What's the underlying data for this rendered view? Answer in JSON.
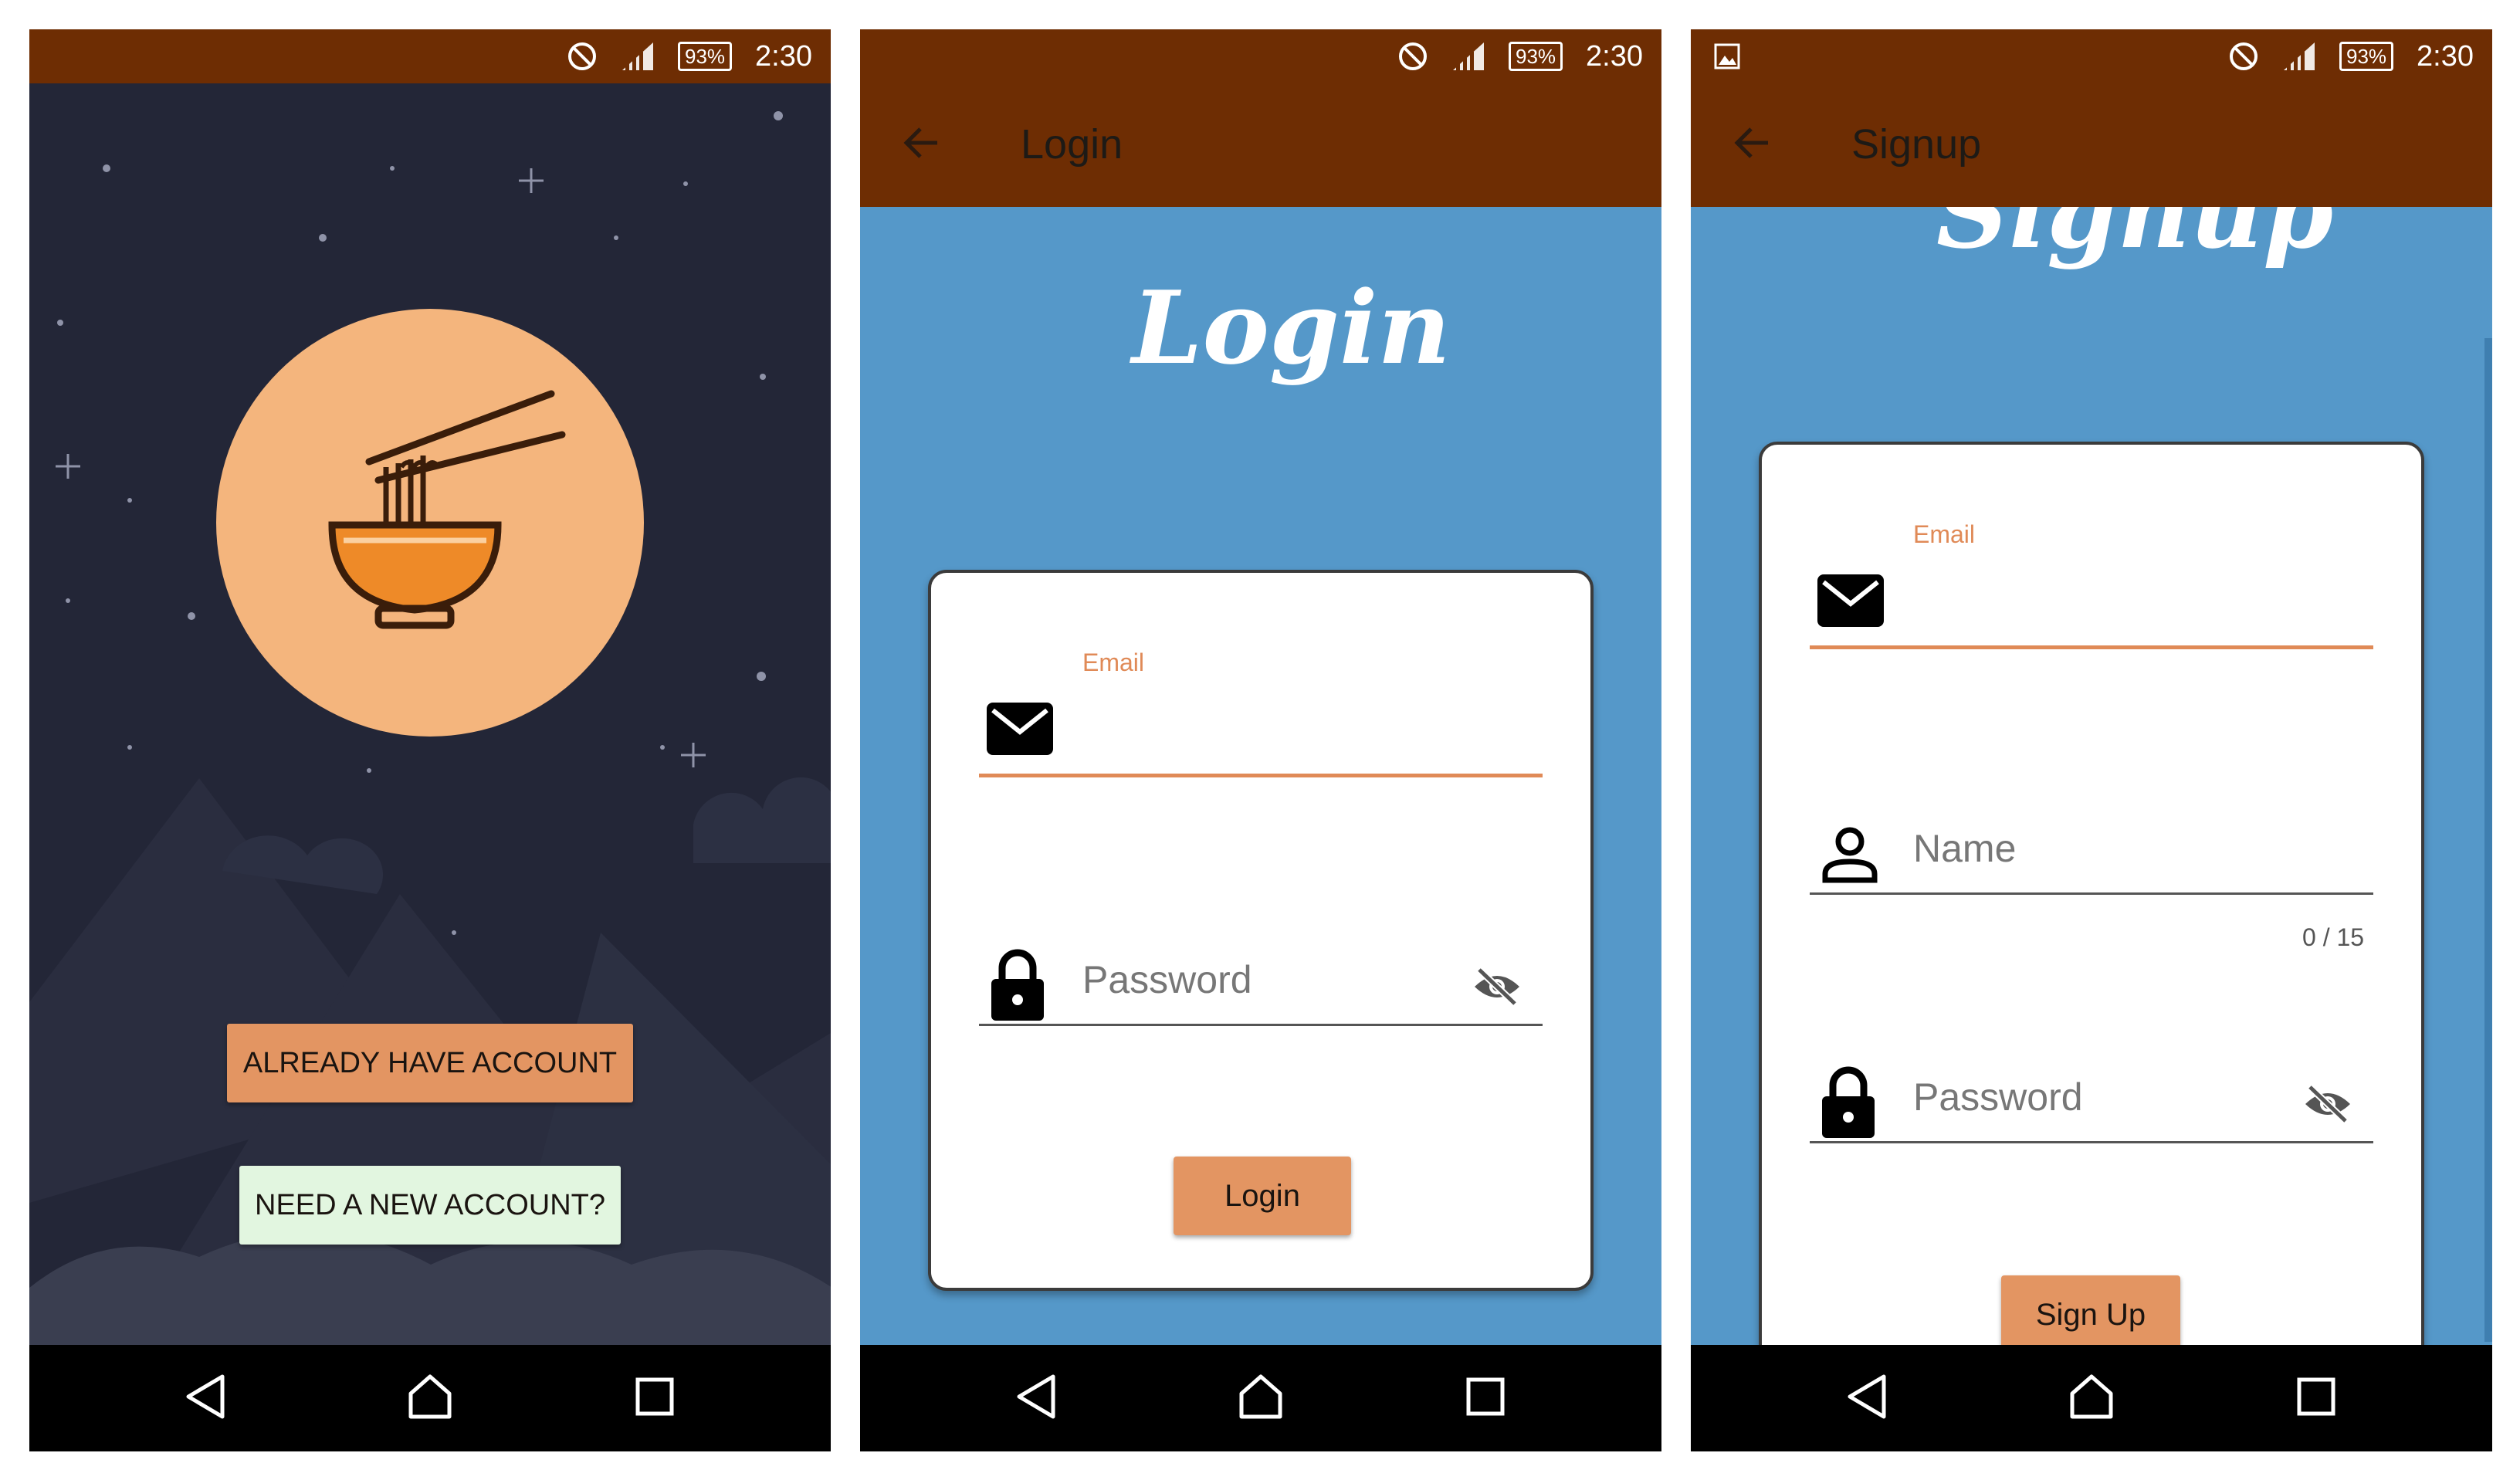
{
  "status_bar": {
    "battery": "93%",
    "time": "2:30"
  },
  "welcome": {
    "already_have_account": "ALREADY HAVE ACCOUNT",
    "need_new_account": "NEED A NEW ACCOUNT?"
  },
  "login": {
    "appbar_title": "Login",
    "heading": "Login",
    "email_label": "Email",
    "password_placeholder": "Password",
    "submit": "Login"
  },
  "signup": {
    "appbar_title": "Signup",
    "heading": "Signup",
    "email_label": "Email",
    "name_placeholder": "Name",
    "name_counter": "0 / 15",
    "password_placeholder": "Password",
    "submit": "Sign Up"
  },
  "colors": {
    "appbar": "#6e2d03",
    "night_bg": "#232637",
    "sky_blue": "#5598c9",
    "accent": "#e39562",
    "logo_circle": "#f4b57d",
    "mint": "#e2f6e0"
  },
  "icons": [
    "do-not-disturb-icon",
    "signal-icon",
    "battery-icon",
    "back-arrow-icon",
    "email-icon",
    "lock-icon",
    "person-icon",
    "visibility-off-icon",
    "nav-back-icon",
    "nav-home-icon",
    "nav-recents-icon",
    "image-notification-icon",
    "noodle-bowl-icon"
  ]
}
